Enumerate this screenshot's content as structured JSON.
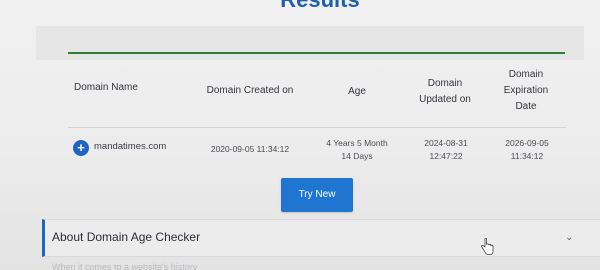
{
  "results": {
    "heading": "Results"
  },
  "table": {
    "headers": {
      "domain_name": "Domain Name",
      "created_on": "Domain Created on",
      "age": "Age",
      "updated_on_line1": "Domain",
      "updated_on_line2": "Updated on",
      "expiration_line1": "Domain",
      "expiration_line2": "Expiration",
      "expiration_line3": "Date"
    },
    "rows": [
      {
        "expand_symbol": "+",
        "domain": "mandatimes.com",
        "created": "2020-09-05 11:34:12",
        "age_line1": "4 Years 5 Month",
        "age_line2": "14 Days",
        "updated_line1": "2024-08-31",
        "updated_line2": "12:47:22",
        "expiration_line1": "2026-09-05",
        "expiration_line2": "11:34:12"
      }
    ]
  },
  "actions": {
    "try_new_label": "Try New"
  },
  "about": {
    "title": "About Domain Age Checker",
    "chevron_icon": "chevron-down-icon",
    "intro_fragment": "When it comes to a website's history"
  },
  "colors": {
    "accent_blue": "#1f75cf",
    "divider_green": "#2e7d32"
  }
}
